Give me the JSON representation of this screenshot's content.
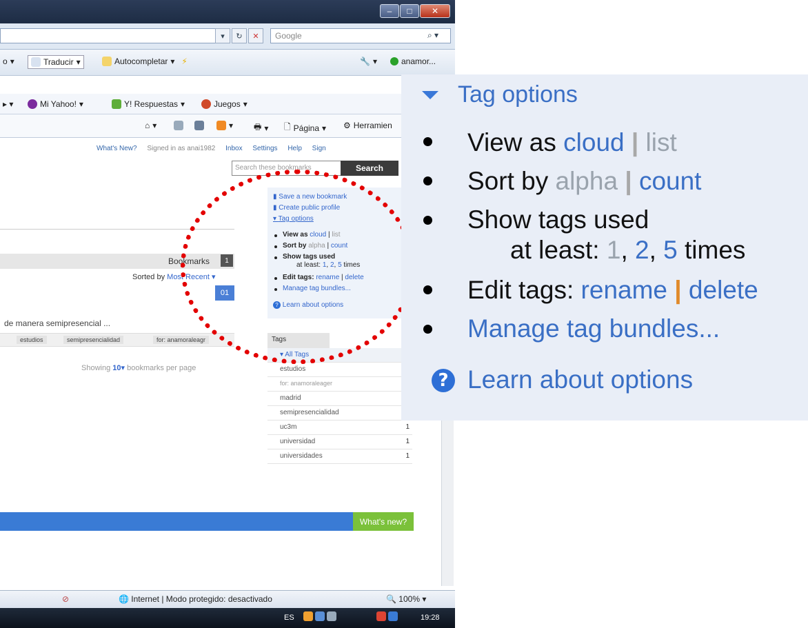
{
  "window": {
    "search_placeholder": "Google",
    "toolbar1": {
      "item1": "o",
      "translate": "Traducir",
      "autocomplete": "Autocompletar",
      "account": "anamor..."
    },
    "toolbar2": {
      "yahoo": "Mi Yahoo!",
      "answers": "Y! Respuestas",
      "games": "Juegos"
    },
    "toolbar3": {
      "page": "Página",
      "tools": "Herramien"
    }
  },
  "page": {
    "top_links": [
      "What's New?",
      "Signed in as anai1982",
      "Inbox",
      "Settings",
      "Help",
      "Sign"
    ],
    "search_placeholder": "Search these bookmarks",
    "search_button": "Search",
    "sidebar": {
      "save": "Save a new bookmark",
      "profile": "Create public profile",
      "tag_options": "Tag options",
      "view_as": "View as",
      "cloud": "cloud",
      "list": "list",
      "sort_by": "Sort by",
      "alpha": "alpha",
      "count": "count",
      "show_tags": "Show tags used",
      "at_least": "at least:",
      "times": "times",
      "edit_tags": "Edit tags:",
      "rename": "rename",
      "delete": "delete",
      "manage": "Manage tag bundles...",
      "learn": "Learn about options"
    },
    "bookmarks_label": "Bookmarks",
    "bookmarks_count": "1",
    "sorted_by": "Sorted by",
    "sort_value": "Most Recent",
    "date_badge": "01",
    "snippet": "de manera semipresencial ...",
    "tag_chips": [
      "estudios",
      "semipresencialidad",
      "for: anamoraleagr"
    ],
    "showing": "Showing",
    "per_page": "10",
    "per_page_suffix": "bookmarks per page",
    "tags_header": "Tags",
    "all_tags": "All Tags",
    "tag_list": [
      {
        "name": "estudios",
        "count": ""
      },
      {
        "name": "for: anamoraleager",
        "count": ""
      },
      {
        "name": "madrid",
        "count": ""
      },
      {
        "name": "semipresencialidad",
        "count": ""
      },
      {
        "name": "uc3m",
        "count": "1"
      },
      {
        "name": "universidad",
        "count": "1"
      },
      {
        "name": "universidades",
        "count": "1"
      }
    ],
    "whats_new": "What's new?"
  },
  "status": {
    "zone": "Internet | Modo protegido: desactivado",
    "zoom": "100%"
  },
  "taskbar": {
    "lang": "ES",
    "time": "19:28"
  },
  "callout": {
    "title": "Tag options",
    "view_as": "View as",
    "cloud": "cloud",
    "list": "list",
    "sort_by": "Sort by",
    "alpha": "alpha",
    "count": "count",
    "show_tags": "Show tags used",
    "at_least": "at least:",
    "n1": "1",
    "n2": "2",
    "n5": "5",
    "times": "times",
    "edit_tags": "Edit tags:",
    "rename": "rename",
    "delete": "delete",
    "manage": "Manage tag bundles...",
    "learn": "Learn about options"
  },
  "colors": {
    "link": "#3a6fc5",
    "annotation": "#e30000",
    "callout_bg": "#e9eef7"
  }
}
